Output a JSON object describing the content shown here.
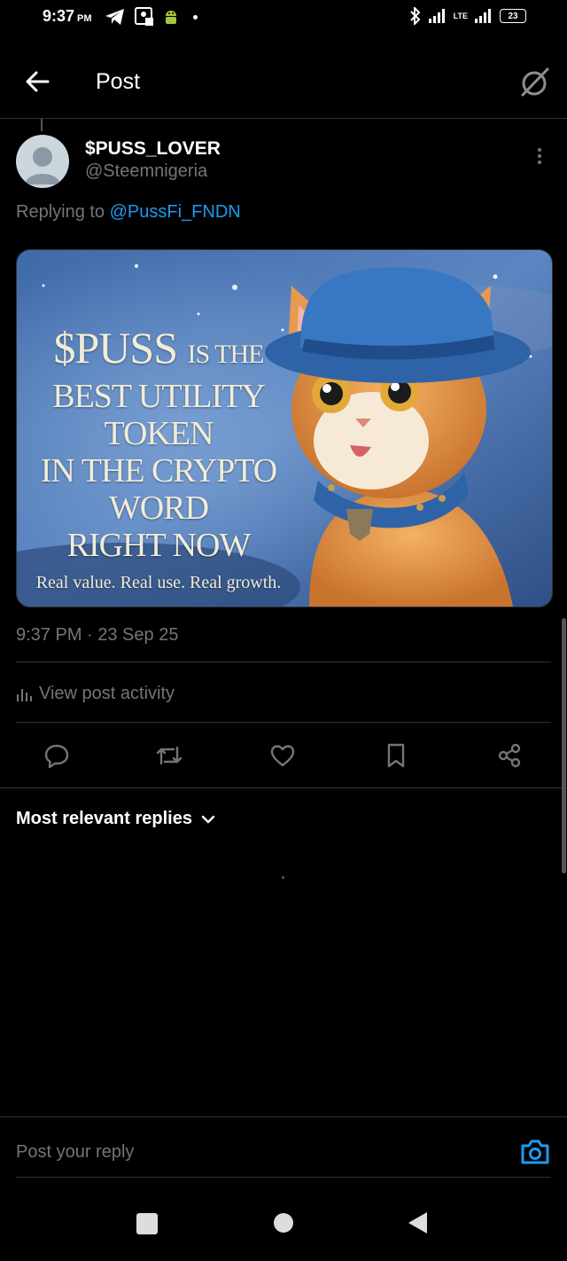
{
  "status_bar": {
    "time": "9:37",
    "ampm": "PM",
    "battery": "23",
    "network": "LTE"
  },
  "header": {
    "title": "Post"
  },
  "post": {
    "display_name": "$PUSS_LOVER",
    "handle": "@Steemnigeria",
    "replying_prefix": "Replying to",
    "replying_to": "@PussFi_FNDN",
    "image_text": {
      "line1_big": "$PUSS",
      "line1_small": "IS THE",
      "line2": "BEST UTILITY TOKEN",
      "line3": "IN THE CRYPTO WORD",
      "line4": "RIGHT NOW",
      "tagline": "Real value. Real use. Real growth."
    },
    "timestamp": "9:37 PM · 23 Sep 25",
    "activity_label": "View post activity"
  },
  "actions": [
    "reply-icon",
    "repost-icon",
    "like-icon",
    "bookmark-icon",
    "share-icon"
  ],
  "replies": {
    "sort_label": "Most relevant replies"
  },
  "composer": {
    "placeholder": "Post your reply"
  },
  "colors": {
    "accent": "#1d9bf0",
    "muted": "#71767b",
    "background": "#000000",
    "divider": "#2f3336"
  }
}
